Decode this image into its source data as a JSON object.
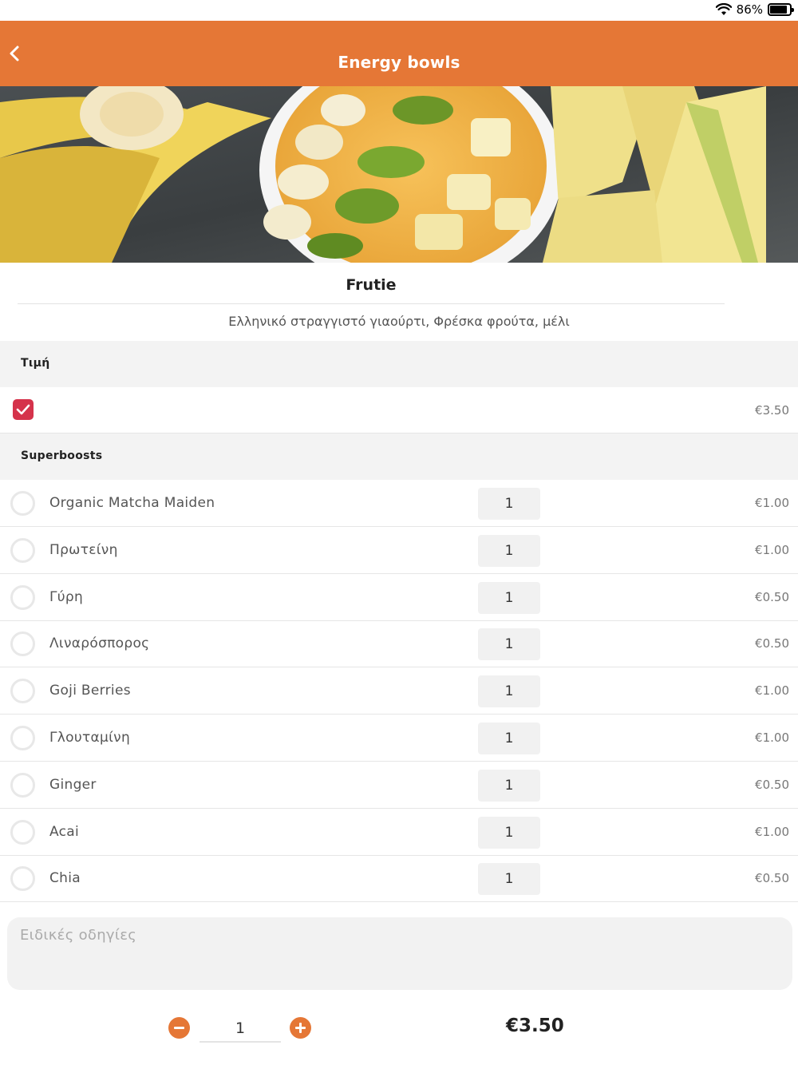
{
  "status_bar": {
    "battery_percent": "86%",
    "battery_level": 0.86
  },
  "nav": {
    "title": "Energy bowls",
    "back_icon": "chevron-left-icon"
  },
  "product": {
    "name": "Frutie",
    "description": "Ελληνικό στραγγιστό γιαούρτι, Φρέσκα φρούτα, μέλι"
  },
  "price_section": {
    "header": "Τιμή",
    "checked": true,
    "price": "€3.50"
  },
  "superboosts": {
    "header": "Superboosts",
    "items": [
      {
        "name": "Organic Matcha Maiden",
        "qty": "1",
        "price": "€1.00"
      },
      {
        "name": "Πρωτείνη",
        "qty": "1",
        "price": "€1.00"
      },
      {
        "name": "Γύρη",
        "qty": "1",
        "price": "€0.50"
      },
      {
        "name": "Λιναρόσπορος",
        "qty": "1",
        "price": "€0.50"
      },
      {
        "name": "Goji Berries",
        "qty": "1",
        "price": "€1.00"
      },
      {
        "name": "Γλουταμίνη",
        "qty": "1",
        "price": "€1.00"
      },
      {
        "name": "Ginger",
        "qty": "1",
        "price": "€0.50"
      },
      {
        "name": "Acai",
        "qty": "1",
        "price": "€1.00"
      },
      {
        "name": "Chia",
        "qty": "1",
        "price": "€0.50"
      }
    ]
  },
  "instructions": {
    "placeholder": "Ειδικές οδηγίες"
  },
  "footer": {
    "quantity": "1",
    "total": "€3.50"
  },
  "colors": {
    "accent": "#e57736",
    "checkbox": "#d5334b"
  }
}
